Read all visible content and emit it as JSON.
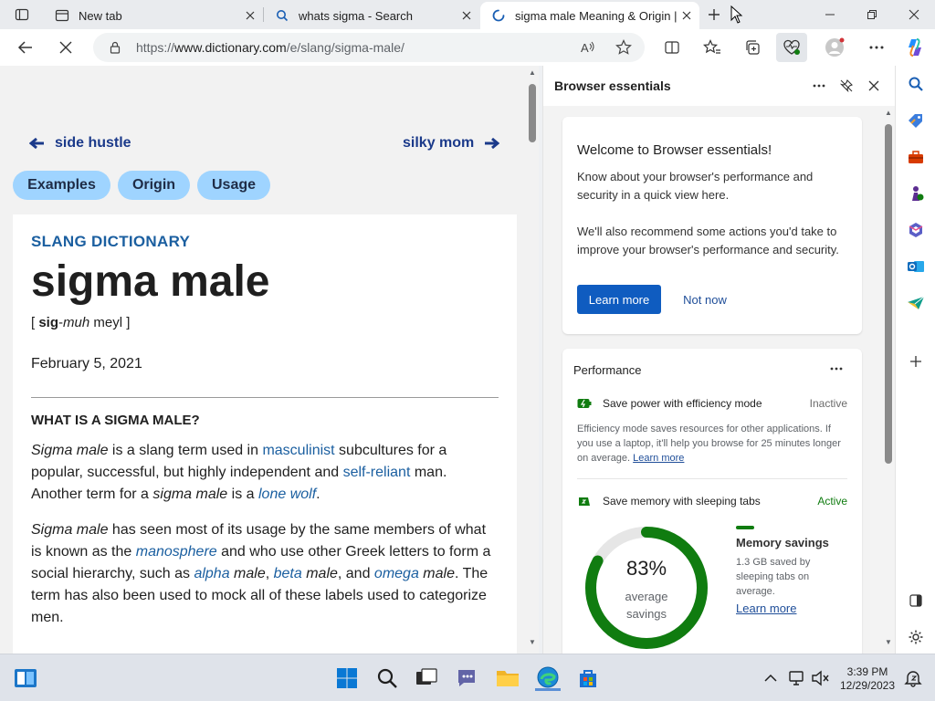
{
  "browser": {
    "tabs": [
      {
        "title": "New tab",
        "icon": "new-tab-page-icon"
      },
      {
        "title": "whats sigma - Search",
        "icon": "search-icon"
      },
      {
        "title": "sigma male Meaning & Origin | S",
        "icon": "loading-icon",
        "active": true
      }
    ],
    "address": {
      "prefix": "https://",
      "host": "www.dictionary.com",
      "path": "/e/slang/sigma-male/"
    }
  },
  "page": {
    "prev_link": "side hustle",
    "next_link": "silky mom",
    "pills": [
      "Examples",
      "Origin",
      "Usage"
    ],
    "section_label": "SLANG DICTIONARY",
    "headword": "sigma male",
    "pronunciation": {
      "open": "[ ",
      "strong": "sig",
      "dash": "-",
      "italic": "muh",
      "rest": " meyl ]"
    },
    "date": "February 5, 2021",
    "question": "WHAT IS A SIGMA MALE?",
    "p1": {
      "t1": "Sigma male",
      "t2": " is a slang term used in ",
      "l1": "masculinist",
      "t3": " subcultures for a popular, successful, but highly independent and ",
      "l2": "self-reliant",
      "t4": " man. Another term for a ",
      "t5": "sigma male",
      "t6": " is a ",
      "l3": "lone wolf",
      "t7": "."
    },
    "p2": {
      "t1": "Sigma male",
      "t2": " has seen most of its usage by the same members of what is known as the ",
      "l1": "manosphere",
      "t3": " and who use other Greek letters to form a social hierarchy, such as ",
      "l2": "alpha",
      "t4": " male",
      "t5": ", ",
      "l3": "beta",
      "t6": " male",
      "t7": ", and ",
      "l4": "omega",
      "t8": " male",
      "t9": ". The term has also been used to mock all of these labels used to categorize men."
    }
  },
  "panel": {
    "title": "Browser essentials",
    "welcome": {
      "heading": "Welcome to Browser essentials!",
      "p1": "Know about your browser's performance and security in a quick view here.",
      "p2": "We'll also recommend some actions you'd take to improve your browser's performance and security.",
      "learn_more": "Learn more",
      "not_now": "Not now"
    },
    "performance": {
      "heading": "Performance",
      "efficiency": {
        "label": "Save power with efficiency mode",
        "status": "Inactive",
        "desc": "Efficiency mode saves resources for other applications. If you use a laptop, it'll help you browse for 25 minutes longer on average. ",
        "link": "Learn more"
      },
      "sleeping": {
        "label": "Save memory with sleeping tabs",
        "status": "Active"
      },
      "donut": {
        "value": "83%",
        "fraction": 0.83,
        "label1": "average",
        "label2": "savings"
      },
      "memory": {
        "title": "Memory savings",
        "desc": "1.3 GB saved by sleeping tabs on average.",
        "link": "Learn more"
      }
    }
  },
  "taskbar": {
    "time": "3:39 PM",
    "date": "12/29/2023"
  },
  "colors": {
    "accent": "#0f5cc0",
    "link": "#1b5fa0",
    "pill": "#9fd4ff",
    "active_green": "#107c10",
    "inactive_gray": "#6b6b6b"
  }
}
